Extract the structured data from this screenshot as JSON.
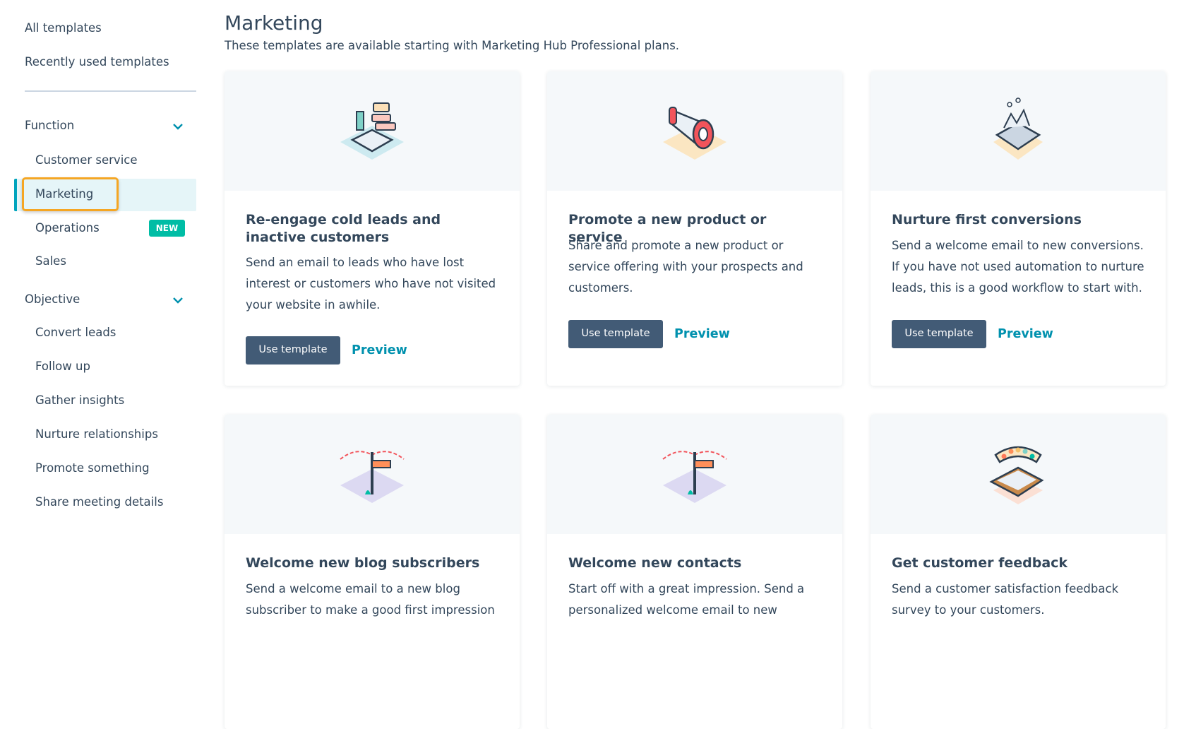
{
  "sidebar": {
    "all_templates": "All templates",
    "recent": "Recently used templates",
    "function": {
      "label": "Function",
      "items": [
        "Customer service",
        "Marketing",
        "Operations",
        "Sales"
      ]
    },
    "new_badge": "NEW",
    "objective": {
      "label": "Objective",
      "items": [
        "Convert leads",
        "Follow up",
        "Gather insights",
        "Nurture relationships",
        "Promote something",
        "Share meeting details"
      ]
    },
    "active": "Marketing"
  },
  "main": {
    "title": "Marketing",
    "subtitle": "These templates are available starting with Marketing Hub Professional plans.",
    "use_label": "Use template",
    "preview_label": "Preview",
    "cards": [
      {
        "title": "Re-engage cold leads and inactive customers",
        "desc": "Send an email to leads who have lost interest or customers who have not visited your website in awhile.",
        "icon": "open-book-icon"
      },
      {
        "title": "Promote a new product or service",
        "desc": "Share and promote a new product or service offering with your prospects and customers.",
        "icon": "megaphone-icon"
      },
      {
        "title": "Nurture first conversions",
        "desc": "Send a welcome email to new conversions. If you have not used automation to nurture leads, this is a good workflow to start with.",
        "icon": "conveyor-icon"
      },
      {
        "title": "Welcome new blog subscribers",
        "desc": "Send a welcome email to a new blog subscriber to make a good first impression",
        "icon": "welcome-sign-icon"
      },
      {
        "title": "Welcome new contacts",
        "desc": "Start off with a great impression. Send a personalized welcome email to new",
        "icon": "welcome-sign-icon"
      },
      {
        "title": "Get customer feedback",
        "desc": "Send a customer satisfaction feedback survey to your customers.",
        "icon": "clipboard-feedback-icon"
      }
    ]
  },
  "colors": {
    "accent": "#00a4bd",
    "button": "#425b76",
    "link": "#0091ae",
    "focus": "#f5a623",
    "badge": "#00bda5"
  }
}
